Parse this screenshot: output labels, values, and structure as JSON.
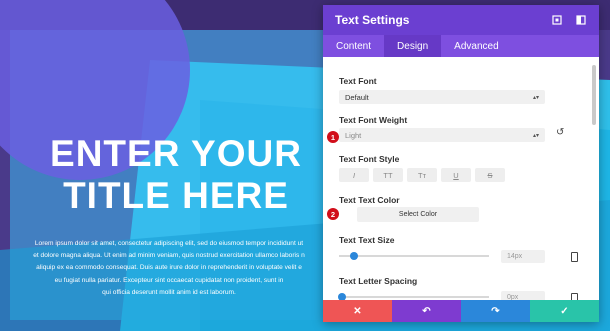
{
  "hero": {
    "title_line1": "ENTER YOUR",
    "title_line2": "TITLE HERE",
    "paragraph": [
      "Lorem ipsum dolor sit amet, consectetur adipiscing elit, sed do eiusmod tempor incididunt ut",
      "et dolore magna aliqua. Ut enim ad minim veniam, quis nostrud exercitation ullamco laboris n",
      "aliquip ex ea commodo consequat. Duis aute irure dolor in reprehenderit in voluptate velit e",
      "eu fugiat nulla pariatur. Excepteur sint occaecat cupidatat non proident, sunt in",
      "qui officia deserunt mollit anim id est laborum."
    ]
  },
  "panel": {
    "title": "Text Settings",
    "tabs": [
      "Content",
      "Design",
      "Advanced"
    ],
    "active_tab": "Design",
    "text_font_label": "Text Font",
    "text_font_value": "Default",
    "font_weight_label": "Text Font Weight",
    "font_weight_value": "Light",
    "font_style_label": "Text Font Style",
    "font_style_buttons": [
      "I",
      "TT",
      "Tт",
      "U",
      "S"
    ],
    "text_color_label": "Text Text Color",
    "select_color_label": "Select Color",
    "text_size_label": "Text Text Size",
    "text_size_value": "14px",
    "text_size_level": 0.1,
    "letter_spacing_label": "Text Letter Spacing",
    "letter_spacing_value": "0px",
    "letter_spacing_level": 0.02
  },
  "markers": [
    "1",
    "2"
  ],
  "icons": {
    "expand": "expand-icon",
    "split": "split-view-icon",
    "reset": "reset-icon",
    "device": "mobile-device-icon",
    "cancel": "close-icon",
    "undo": "undo-icon",
    "redo": "redo-icon",
    "save": "check-icon"
  },
  "colors": {
    "header": "#6b3fd1",
    "tabs": "#7e4fe0",
    "cancel": "#ef5555",
    "undo": "#7e3bd0",
    "redo": "#2b87da",
    "save": "#29c4a9",
    "marker": "#d10e1a"
  }
}
